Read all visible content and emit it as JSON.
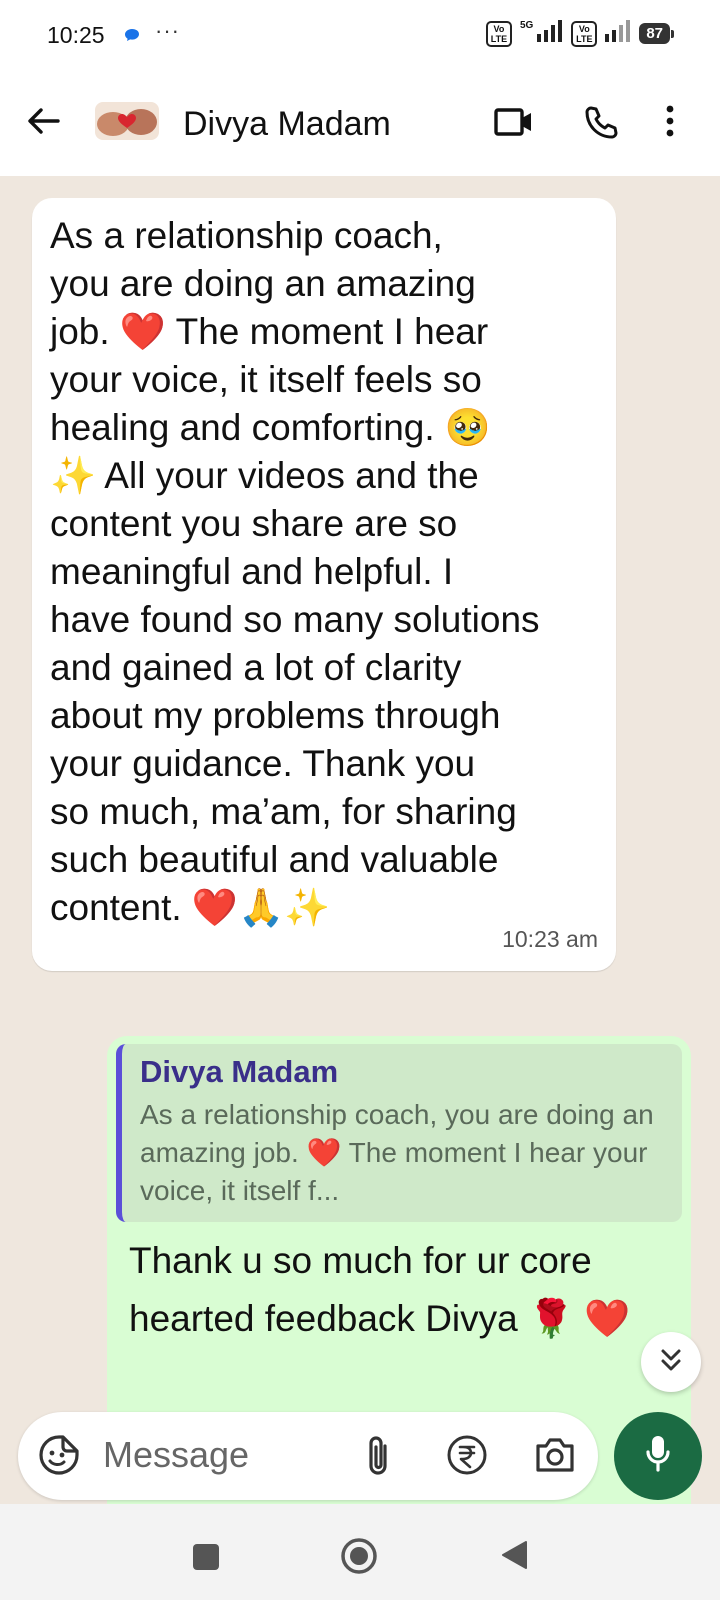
{
  "status_bar": {
    "time": "10:25",
    "network": "5G",
    "volte_label": "Vo LTE",
    "battery": "87"
  },
  "header": {
    "contact_name": "Divya Madam"
  },
  "messages": {
    "incoming": {
      "text": "As a relationship coach,\nyou are doing an amazing\njob. ❤️ The moment I hear\nyour voice, it itself feels so\nhealing and comforting. 🥹\n✨ All your videos and the\ncontent you share are so\nmeaningful and helpful. I\nhave found so many solutions\nand gained a lot of clarity\nabout my problems through\nyour guidance. Thank you\nso much, ma’am, for sharing\nsuch beautiful and valuable\ncontent. ❤️🙏✨",
      "time": "10:23 am"
    },
    "outgoing": {
      "quote_author": "Divya Madam",
      "quote_text": "As a relationship coach, you are doing an amazing job. ❤️ The moment I hear your voice, it itself f...",
      "text": "Thank u so much for ur core hearted feedback Divya 🌹 ❤️"
    }
  },
  "composer": {
    "placeholder": "Message"
  },
  "colors": {
    "accent": "#1b6b43",
    "outgoing_bubble": "#d9fdd3",
    "chat_background": "#efe7de",
    "quote_bar": "#5b4fd8"
  },
  "icons": {
    "back": "arrow-left-icon",
    "video": "video-camera-icon",
    "call": "phone-icon",
    "more": "more-vertical-icon",
    "emoji": "sticker-smile-icon",
    "attach": "paperclip-icon",
    "rupee": "rupee-icon",
    "camera": "camera-icon",
    "mic": "microphone-icon",
    "scroll_down": "chevron-double-down-icon"
  }
}
